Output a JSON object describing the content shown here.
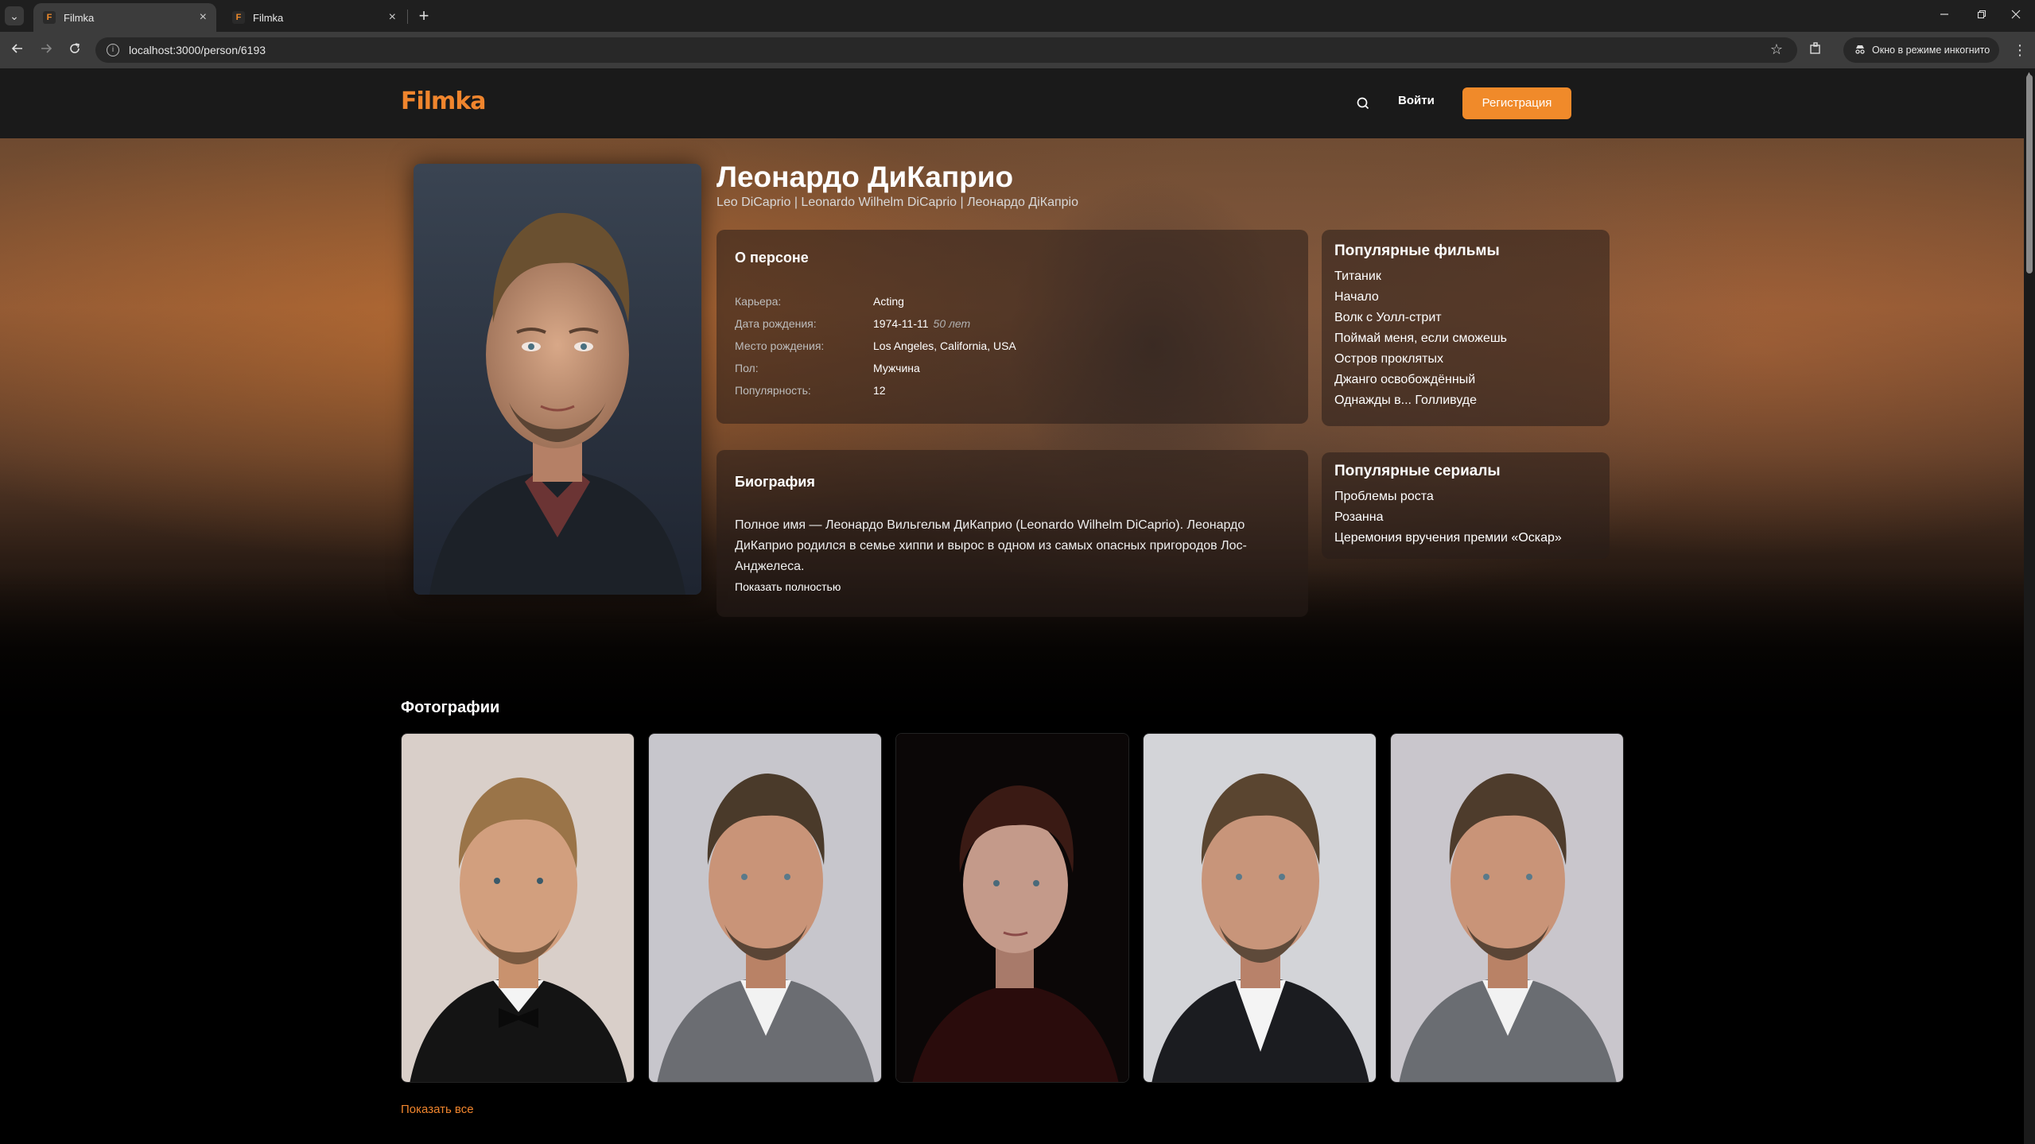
{
  "browser": {
    "tabs": [
      {
        "favicon": "F",
        "title": "Filmka",
        "close": "×"
      },
      {
        "favicon": "F",
        "title": "Filmka",
        "close": "×"
      }
    ],
    "tab_list_glyph": "⌄",
    "new_tab_glyph": "+",
    "url": "localhost:3000/person/6193",
    "incognito_label": "Окно в режиме инкогнито"
  },
  "site": {
    "logo": "Filmka",
    "login": "Войти",
    "register": "Регистрация",
    "accent_color": "#f08a2a"
  },
  "person": {
    "name": "Леонардо ДиКаприо",
    "aliases": "Leo DiCaprio | Leonardo Wilhelm DiCaprio | Леонардо ДіКапріо",
    "about": {
      "title": "О персоне",
      "rows": [
        {
          "label": "Карьера:",
          "value": "Acting"
        },
        {
          "label": "Дата рождения:",
          "value": "1974-11-11",
          "extra": "50 лет"
        },
        {
          "label": "Место рождения:",
          "value": "Los Angeles, California, USA"
        },
        {
          "label": "Пол:",
          "value": "Мужчина"
        },
        {
          "label": "Популярность:",
          "value": "12"
        }
      ]
    },
    "biography": {
      "title": "Биография",
      "text": "Полное имя — Леонардо Вильгельм ДиКаприо (Leonardo Wilhelm DiCaprio). Леонардо ДиКаприо родился в семье хиппи и вырос в одном из самых опасных пригородов Лос-Анджелеса.",
      "show_more": "Показать полностью"
    },
    "popular_movies": {
      "title": "Популярные фильмы",
      "items": [
        "Титаник",
        "Начало",
        "Волк с Уолл-стрит",
        "Поймай меня, если сможешь",
        "Остров проклятых",
        "Джанго освобождённый",
        "Однажды в... Голливуде"
      ]
    },
    "popular_series": {
      "title": "Популярные сериалы",
      "items": [
        "Проблемы роста",
        "Розанна",
        "Церемония вручения премии «Оскар»"
      ]
    }
  },
  "photos": {
    "title": "Фотографии",
    "show_all": "Показать все"
  }
}
